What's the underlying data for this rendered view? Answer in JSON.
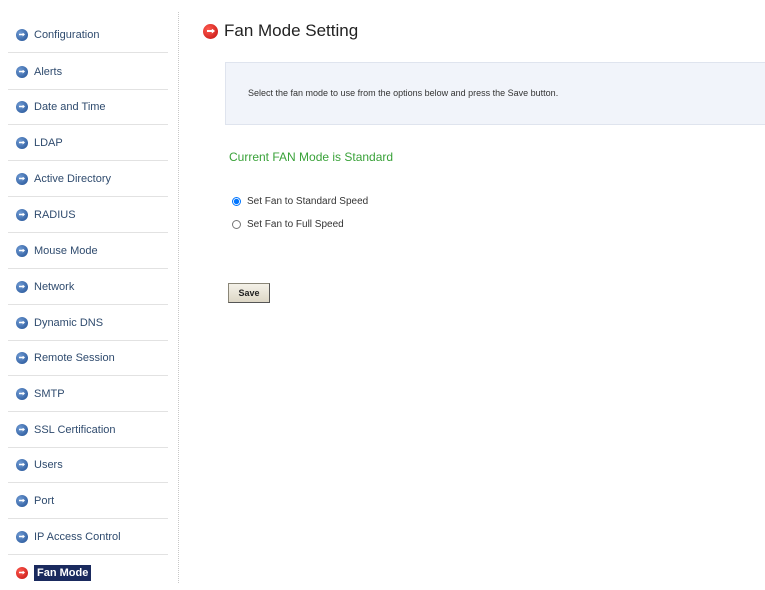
{
  "sidebar": {
    "items": [
      {
        "label": "Configuration",
        "active": false
      },
      {
        "label": "Alerts",
        "active": false
      },
      {
        "label": "Date and Time",
        "active": false
      },
      {
        "label": "LDAP",
        "active": false
      },
      {
        "label": "Active Directory",
        "active": false
      },
      {
        "label": "RADIUS",
        "active": false
      },
      {
        "label": "Mouse Mode",
        "active": false
      },
      {
        "label": "Network",
        "active": false
      },
      {
        "label": "Dynamic DNS",
        "active": false
      },
      {
        "label": "Remote Session",
        "active": false
      },
      {
        "label": "SMTP",
        "active": false
      },
      {
        "label": "SSL Certification",
        "active": false
      },
      {
        "label": "Users",
        "active": false
      },
      {
        "label": "Port",
        "active": false
      },
      {
        "label": "IP Access Control",
        "active": false
      },
      {
        "label": "Fan Mode",
        "active": true
      }
    ]
  },
  "main": {
    "title": "Fan Mode Setting",
    "instructions": "Select the fan mode to use from the options below and press the Save button.",
    "current_mode": "Current FAN Mode is Standard",
    "options": [
      {
        "label": "Set Fan to Standard Speed",
        "checked": true
      },
      {
        "label": "Set Fan to Full Speed",
        "checked": false
      }
    ],
    "save_label": "Save"
  },
  "colors": {
    "nav_text": "#2f4b6e",
    "active_bg": "#1a2a5e",
    "current_mode_text": "#39a239",
    "info_box_bg": "#f1f4fa"
  }
}
